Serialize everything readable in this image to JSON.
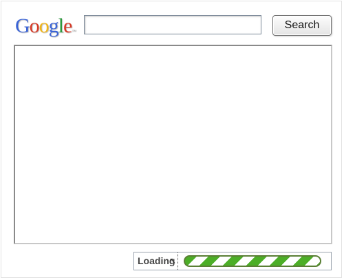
{
  "header": {
    "logo_letters": [
      "G",
      "o",
      "o",
      "g",
      "l",
      "e"
    ],
    "logo_colors": [
      "#3b64d6",
      "#d73925",
      "#f1b416",
      "#3b64d6",
      "#2b9a3c",
      "#d73925"
    ],
    "logo_tm": "™",
    "search_value": "",
    "search_button_label": "Search"
  },
  "results": {
    "content": ""
  },
  "status": {
    "loading_label": "Loading",
    "progress_color": "#4cae27"
  },
  "icons": {
    "cursor": "cursor-icon"
  }
}
